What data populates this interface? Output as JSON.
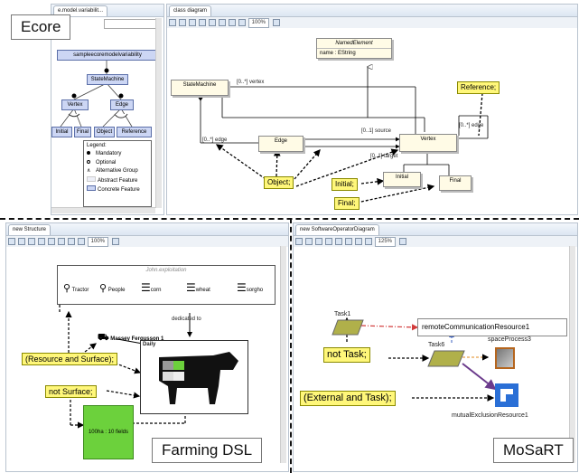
{
  "corner_labels": {
    "ecore": "Ecore",
    "farming": "Farming DSL",
    "mosart": "MoSaRT"
  },
  "ecore": {
    "left_tab": "e.model.variabilit...",
    "feature_root": "sampleecoremodelvariability",
    "feature_statemachine": "StateMachine",
    "feature_vertex": "Vertex",
    "feature_edge": "Edge",
    "feature_initial": "Initial",
    "feature_final": "Final",
    "feature_object": "Object",
    "feature_reference": "Reference",
    "legend": {
      "title": "Legend:",
      "items": [
        "Mandatory",
        "Optional",
        "Alternative Group",
        "Abstract Feature",
        "Concrete Feature"
      ]
    },
    "right_tab": "class diagram",
    "zoom": "100%",
    "named_element": "NamedElement",
    "named_attr": "name : EString",
    "state_machine": "StateMachine",
    "edge": "Edge",
    "vertex": "Vertex",
    "initial": "Initial",
    "final": "Final",
    "rel_vertex": "[0..*] vertex",
    "rel_edge": "[0..*] edge",
    "rel_source": "[0..1] source",
    "rel_target": "[0..1] target",
    "rel_edge2": "[0..*] edge",
    "lbl_reference": "Reference;",
    "lbl_object": "Object;",
    "lbl_initial": "Initial;",
    "lbl_final": "Final;"
  },
  "farming": {
    "tab": "new Structure",
    "zoom": "100%",
    "exploitation": "John.exploitation",
    "items": [
      "Tractor",
      "People",
      "corn",
      "wheat",
      "sorgho"
    ],
    "dedicated_to": "dedicated to",
    "tractor_name": "Massey Fergusson 1",
    "daily": "Daily",
    "field": "100ha : 10 fields",
    "lbl_resource": "(Resource and Surface);",
    "lbl_not_surface": "not Surface;"
  },
  "mosart": {
    "tab": "new SoftwareOperatorDiagram",
    "zoom": "125%",
    "task1": "Task1",
    "task6": "Task6",
    "remote": "remoteCommunicationResource1",
    "space": "spaceProcess3",
    "mutual": "mutualExclusionResource1",
    "lbl_not_task": "not Task;",
    "lbl_external": "(External and Task);"
  },
  "colors": {
    "note_yellow": "#fff77a",
    "feature_blue": "#ccd6f4",
    "field_green": "#6cd13c",
    "remote_red": "#d23a3a"
  }
}
